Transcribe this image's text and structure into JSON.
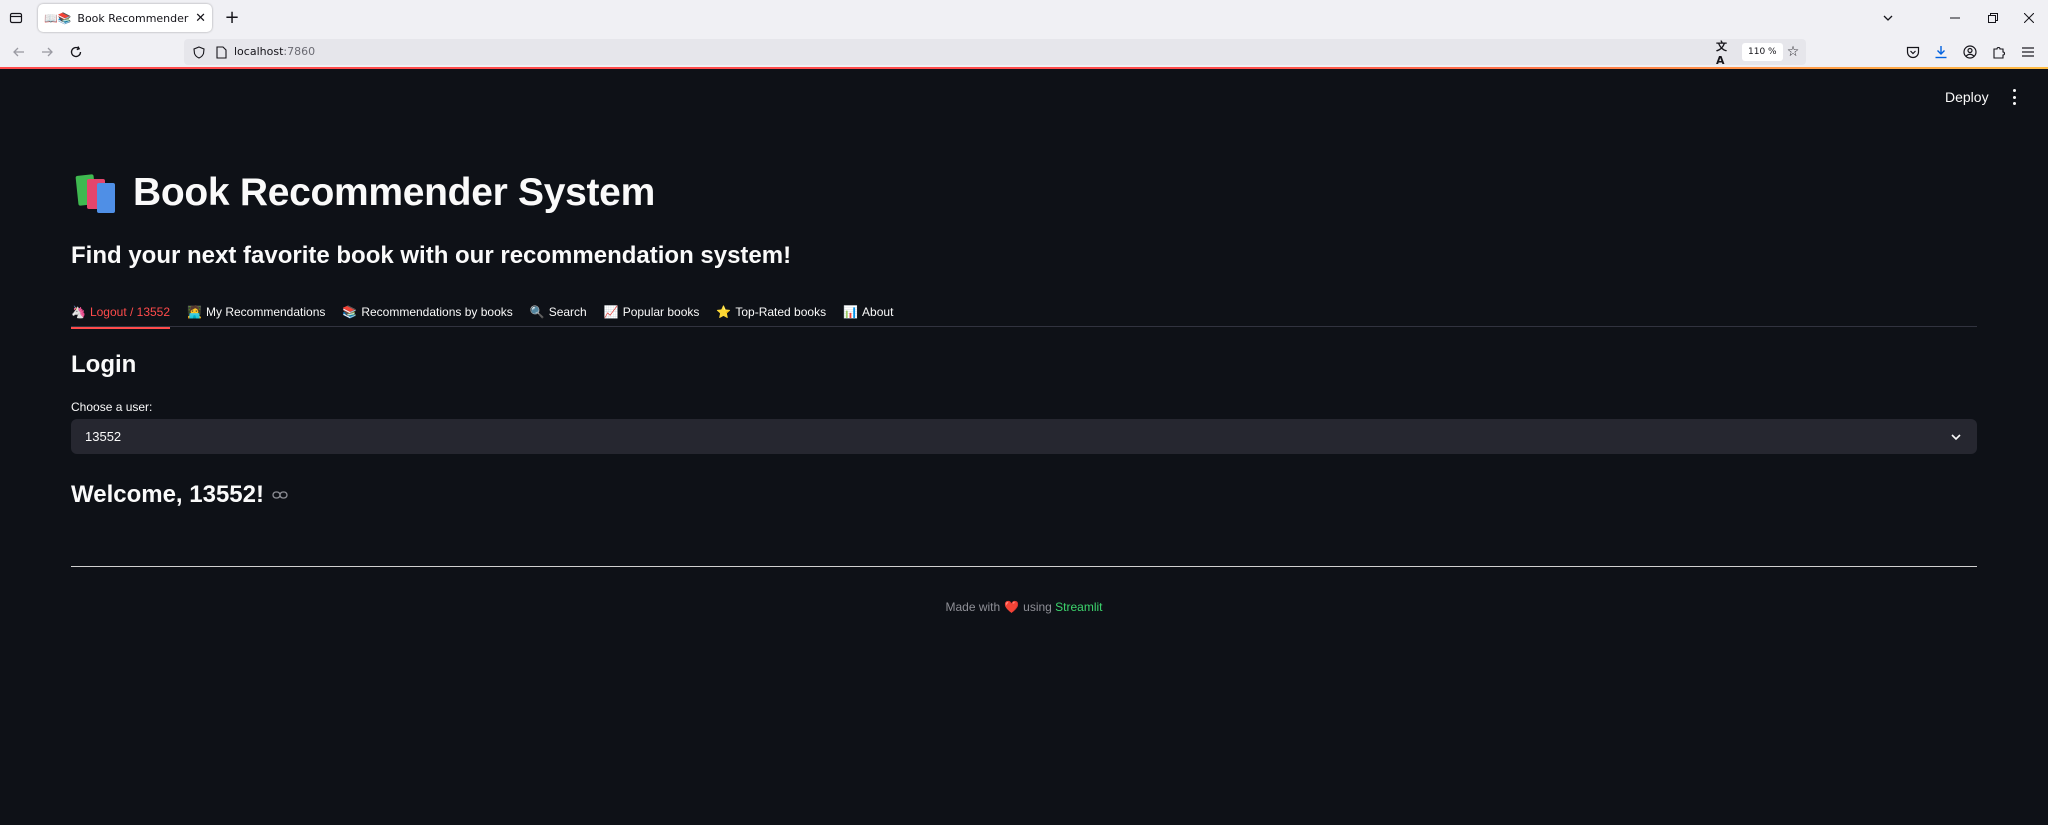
{
  "browser": {
    "tab_title": "Book Recommender System",
    "tab_favicon": "📖📚",
    "url_host": "localhost",
    "url_port": ":7860",
    "zoom": "110 %"
  },
  "app": {
    "deploy_label": "Deploy",
    "title_emoji": "📚",
    "title": "Book Recommender System",
    "subtitle": "Find your next favorite book with our recommendation system!",
    "tabs": [
      {
        "emoji": "🦄",
        "label": "Logout / 13552",
        "active": true
      },
      {
        "emoji": "🧑‍💻",
        "label": "My Recommendations",
        "active": false
      },
      {
        "emoji": "📚",
        "label": "Recommendations by books",
        "active": false
      },
      {
        "emoji": "🔍",
        "label": "Search",
        "active": false
      },
      {
        "emoji": "📈",
        "label": "Popular books",
        "active": false
      },
      {
        "emoji": "⭐",
        "label": "Top-Rated books",
        "active": false
      },
      {
        "emoji": "📊",
        "label": "About",
        "active": false
      }
    ],
    "login_heading": "Login",
    "choose_user_label": "Choose a user:",
    "selected_user": "13552",
    "welcome": "Welcome, 13552!",
    "footer": {
      "made_with": "Made with",
      "heart": "❤️",
      "using": "using",
      "link": "Streamlit"
    }
  },
  "colors": {
    "background": "#0e1117",
    "accent": "#ff4b4b",
    "select_bg": "#262730",
    "link": "#3dd56d"
  }
}
